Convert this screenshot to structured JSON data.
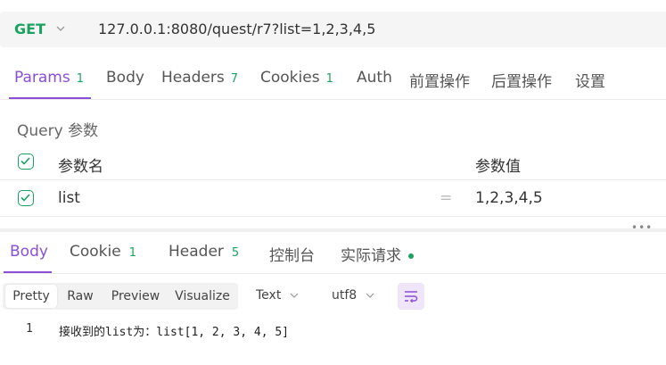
{
  "request": {
    "method": "GET",
    "url": "127.0.0.1:8080/quest/r7?list=1,2,3,4,5"
  },
  "request_tabs": [
    {
      "label": "Params",
      "count": "1"
    },
    {
      "label": "Body",
      "count": ""
    },
    {
      "label": "Headers",
      "count": "7"
    },
    {
      "label": "Cookies",
      "count": "1"
    },
    {
      "label": "Auth",
      "count": ""
    },
    {
      "label": "前置操作",
      "count": ""
    },
    {
      "label": "后置操作",
      "count": ""
    },
    {
      "label": "设置",
      "count": ""
    }
  ],
  "query": {
    "title": "Query 参数",
    "col_name": "参数名",
    "col_value": "参数值",
    "rows": [
      {
        "name": "list",
        "eq": "=",
        "value": "1,2,3,4,5"
      }
    ]
  },
  "more": "•••",
  "response_tabs": [
    {
      "label": "Body",
      "count": ""
    },
    {
      "label": "Cookie",
      "count": "1"
    },
    {
      "label": "Header",
      "count": "5"
    },
    {
      "label": "控制台",
      "count": ""
    },
    {
      "label": "实际请求",
      "count": ""
    }
  ],
  "format": {
    "buttons": [
      "Pretty",
      "Raw",
      "Preview",
      "Visualize"
    ],
    "type_select": "Text",
    "encoding_select": "utf8"
  },
  "response_body": {
    "lines": [
      {
        "num": "1",
        "text": "接收到的list为：list[1, 2, 3, 4, 5]"
      }
    ]
  },
  "colors": {
    "accent": "#8a4fd6",
    "method_green": "#1aa260"
  }
}
